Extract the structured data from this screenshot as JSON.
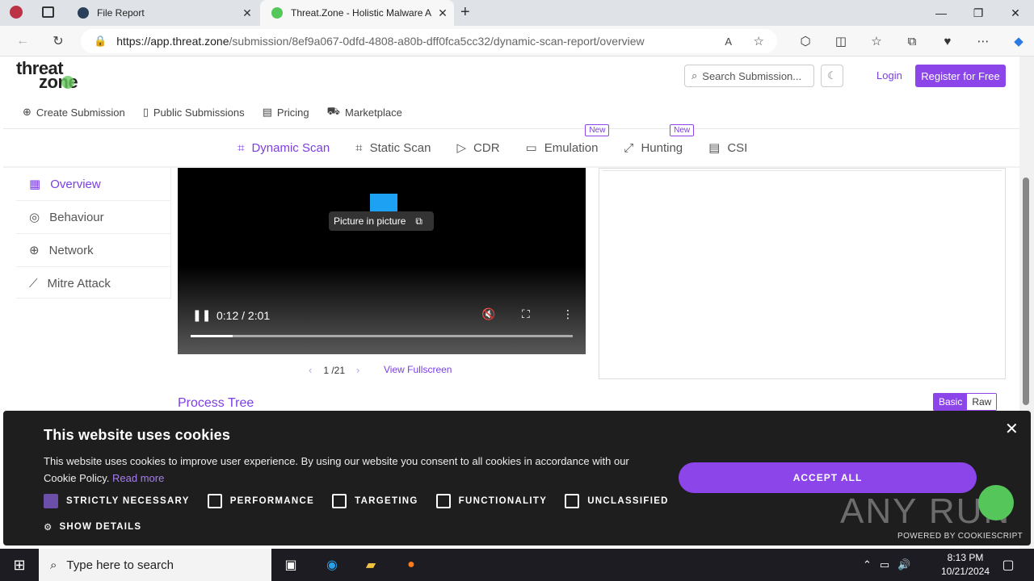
{
  "browser": {
    "tabs": [
      {
        "title": "File Report",
        "close": "✕"
      },
      {
        "title": "Threat.Zone - Holistic Malware A",
        "close": "✕"
      }
    ],
    "new_tab": "+",
    "url_host": "https://app.threat.zone",
    "url_path": "/submission/8ef9a067-0dfd-4808-a80b-dff0fca5cc32/dynamic-scan-report/overview"
  },
  "site": {
    "logo_top": "threat",
    "logo_bottom": "zone",
    "search_placeholder": "Search Submission...",
    "login": "Login",
    "register": "Register for Free",
    "nav": [
      "Create Submission",
      "Public Submissions",
      "Pricing",
      "Marketplace"
    ],
    "scan_tabs": [
      {
        "label": "Dynamic Scan",
        "badge": ""
      },
      {
        "label": "Static Scan",
        "badge": ""
      },
      {
        "label": "CDR",
        "badge": ""
      },
      {
        "label": "Emulation",
        "badge": "New"
      },
      {
        "label": "Hunting",
        "badge": "New"
      },
      {
        "label": "CSI",
        "badge": ""
      }
    ],
    "side_menu": [
      "Overview",
      "Behaviour",
      "Network",
      "Mitre Attack"
    ],
    "video": {
      "pip_label": "Picture in picture",
      "time": "0:12 / 2:01",
      "progress": 0.11
    },
    "pager": {
      "text": "1 /21",
      "view_fullscreen": "View Fullscreen"
    },
    "process_tree_title": "Process Tree",
    "toggle": {
      "basic": "Basic",
      "raw": "Raw"
    }
  },
  "cookie": {
    "title": "This website uses cookies",
    "text": "This website uses cookies to improve user experience. By using our website you consent to all cookies in accordance with our Cookie Policy.",
    "read_more": "Read more",
    "options": [
      {
        "label": "STRICTLY NECESSARY",
        "checked": true
      },
      {
        "label": "PERFORMANCE",
        "checked": false
      },
      {
        "label": "TARGETING",
        "checked": false
      },
      {
        "label": "FUNCTIONALITY",
        "checked": false
      },
      {
        "label": "UNCLASSIFIED",
        "checked": false
      }
    ],
    "show_details": "SHOW DETAILS",
    "accept": "ACCEPT ALL",
    "powered": "POWERED BY COOKIESCRIPT",
    "watermark": "ANY RUN"
  },
  "taskbar": {
    "search_placeholder": "Type here to search",
    "time": "8:13 PM",
    "date": "10/21/2024"
  },
  "colors": {
    "accent": "#8b45e9",
    "cookie_bg": "#1e1e1e",
    "taskbar": "#1c1c22"
  }
}
